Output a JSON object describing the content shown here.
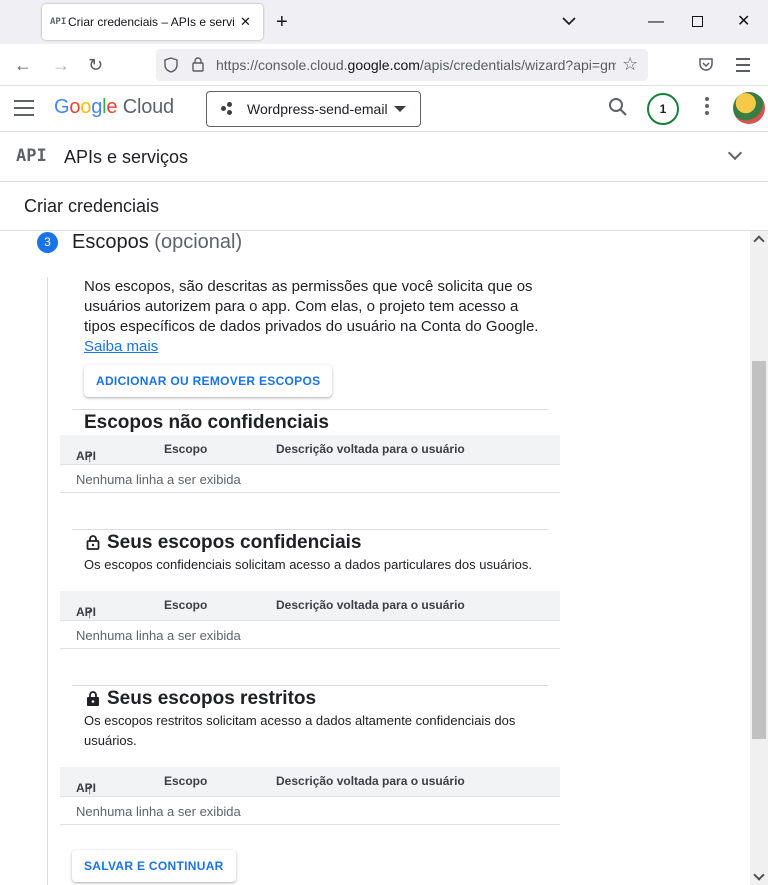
{
  "browser": {
    "tab_title": "Criar credenciais – APIs e serviços",
    "tab_favicon": "API",
    "url_prefix": "https://console.cloud.",
    "url_domain": "google.com",
    "url_suffix": "/apis/credentials/wizard?api=gm"
  },
  "header": {
    "logo": [
      "G",
      "o",
      "o",
      "g",
      "l",
      "e"
    ],
    "logo_cloud": "Cloud",
    "logo_colors": [
      "#4285f4",
      "#ea4335",
      "#fbbc05",
      "#4285f4",
      "#34a853",
      "#ea4335"
    ],
    "project": "Wordpress-send-email",
    "notification_count": "1"
  },
  "subheader": {
    "icon_text": "API",
    "title": "APIs e serviços"
  },
  "page_title": "Criar credenciais",
  "step": {
    "number": "3",
    "title": "Escopos",
    "optional": "(opcional)",
    "intro": "Nos escopos, são descritas as permissões que você solicita que os usuários autorizem para o app. Com elas, o projeto tem acesso a tipos específicos de dados privados do usuário na Conta do Google.",
    "learn_more": "Saiba mais",
    "add_remove_button": "ADICIONAR OU REMOVER ESCOPOS",
    "save_button": "SALVAR E CONTINUAR"
  },
  "table_columns": {
    "api": "API",
    "scope": "Escopo",
    "description": "Descrição voltada para o usuário"
  },
  "sections": {
    "non_sensitive": {
      "title": "Escopos não confidenciais",
      "empty": "Nenhuma linha a ser exibida"
    },
    "sensitive": {
      "title": "Seus escopos confidenciais",
      "desc": "Os escopos confidenciais solicitam acesso a dados particulares dos usuários.",
      "empty": "Nenhuma linha a ser exibida"
    },
    "restricted": {
      "title": "Seus escopos restritos",
      "desc": "Os escopos restritos solicitam acesso a dados altamente confidenciais dos usuários.",
      "empty": "Nenhuma linha a ser exibida"
    }
  },
  "colors": {
    "accent": "#1a73e8",
    "badge_ring": "#188038"
  }
}
